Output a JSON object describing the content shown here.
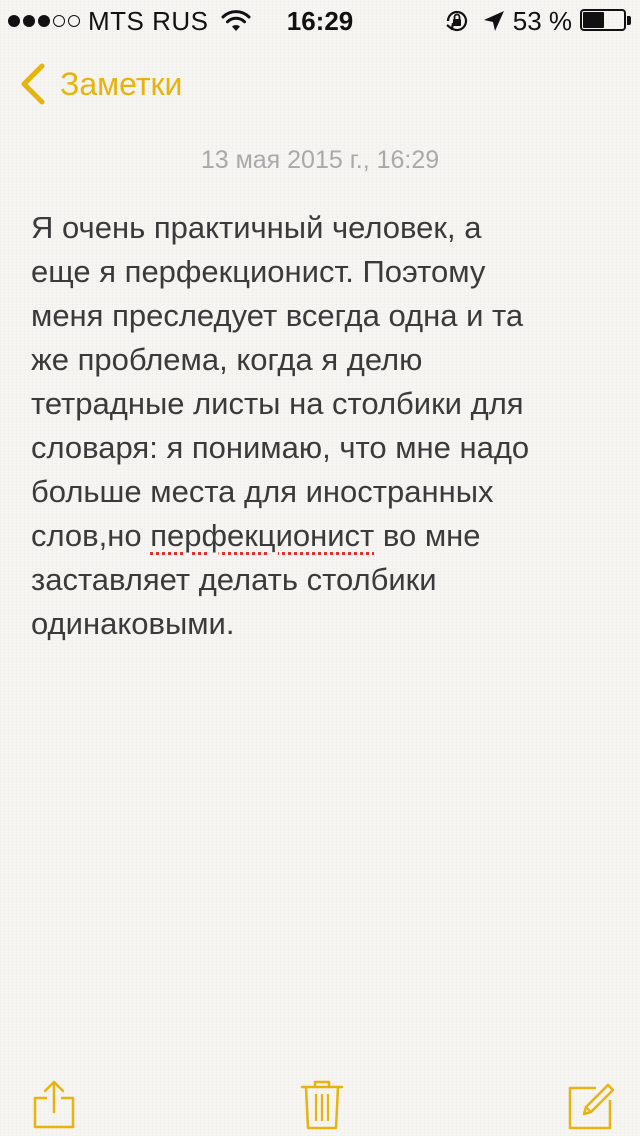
{
  "status_bar": {
    "carrier": "MTS RUS",
    "time": "16:29",
    "battery": "53 %",
    "battery_level": 0.53,
    "signal_bars_filled": 3,
    "signal_bars_total": 5
  },
  "nav": {
    "back_label": "Заметки",
    "back_icon": "chevron-left-icon"
  },
  "note": {
    "date": "13 мая 2015 г., 16:29",
    "lines": [
      "Я очень практичный человек, а",
      "еще я перфекционист. Поэтому",
      "меня преследует всегда одна и та",
      "же проблема, когда я делю",
      "тетрадные листы на столбики для",
      "словаря: я понимаю, что мне надо",
      "больше места для иностранных"
    ],
    "line8_before": "слов,но ",
    "line8_misspelled": "перфекционист",
    "line8_after": " во мне",
    "lines_end": [
      "заставляет делать столбики",
      "одинаковыми."
    ]
  },
  "toolbar": {
    "icons": [
      "share-icon",
      "trash-icon",
      "compose-icon"
    ]
  },
  "colors": {
    "accent": "#e6b40d",
    "background": "#f6f5f2",
    "text": "#3a3a3a",
    "date": "#a9a9a9",
    "spellcheck": "#e03030"
  }
}
